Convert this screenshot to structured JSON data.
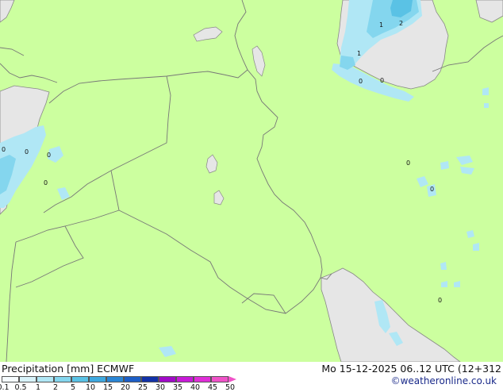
{
  "footer": {
    "title": "Precipitation [mm]  ECMWF",
    "datetime": "Mo 15-12-2025 06..12 UTC (12+312",
    "credit": "©weatheronline.co.uk"
  },
  "legend": {
    "colors": [
      "#f5fcff",
      "#d8f3fa",
      "#b0e7f5",
      "#84d6ee",
      "#5ac2e5",
      "#3ea8df",
      "#2b86d5",
      "#1c5ec6",
      "#1232a8",
      "#a10ac8",
      "#c81ad8",
      "#e02ed8",
      "#f052c8"
    ],
    "ticks": [
      "0.1",
      "0.5",
      "1",
      "2",
      "5",
      "10",
      "15",
      "20",
      "25",
      "30",
      "35",
      "40",
      "45",
      "50"
    ]
  },
  "map": {
    "land_color": "#ccff9f",
    "sea_color": "#e6e6e6",
    "border_color": "#777777",
    "contour_labels": [
      "1",
      "2",
      "1",
      "0",
      "0",
      "0",
      "0",
      "0",
      "0",
      "0",
      "0",
      "0"
    ]
  }
}
